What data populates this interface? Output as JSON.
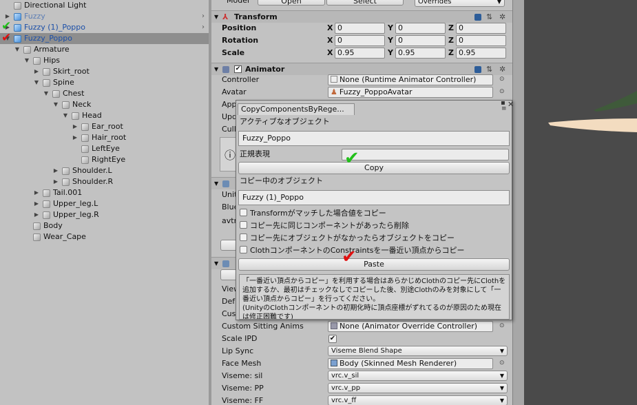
{
  "hierarchy": {
    "rows": [
      {
        "label": "Directional Light",
        "indent": 0,
        "arrow": "",
        "prefab": false,
        "faded": false
      },
      {
        "label": "Fuzzy",
        "indent": 0,
        "arrow": "▶",
        "prefab": true,
        "faded": true,
        "open": true
      },
      {
        "label": "Fuzzy (1)_Poppo",
        "indent": 0,
        "arrow": "▶",
        "prefab": true,
        "faded": false,
        "open": true
      },
      {
        "label": "Fuzzy_Poppo",
        "indent": 0,
        "arrow": "▼",
        "prefab": true,
        "faded": false,
        "selected": true
      },
      {
        "label": "Armature",
        "indent": 1,
        "arrow": "▼"
      },
      {
        "label": "Hips",
        "indent": 2,
        "arrow": "▼"
      },
      {
        "label": "Skirt_root",
        "indent": 3,
        "arrow": "▶"
      },
      {
        "label": "Spine",
        "indent": 3,
        "arrow": "▼"
      },
      {
        "label": "Chest",
        "indent": 4,
        "arrow": "▼"
      },
      {
        "label": "Neck",
        "indent": 5,
        "arrow": "▼"
      },
      {
        "label": "Head",
        "indent": 6,
        "arrow": "▼"
      },
      {
        "label": "Ear_root",
        "indent": 7,
        "arrow": "▶"
      },
      {
        "label": "Hair_root",
        "indent": 7,
        "arrow": "▶"
      },
      {
        "label": "LeftEye",
        "indent": 7,
        "arrow": ""
      },
      {
        "label": "RightEye",
        "indent": 7,
        "arrow": ""
      },
      {
        "label": "Shoulder.L",
        "indent": 5,
        "arrow": "▶"
      },
      {
        "label": "Shoulder.R",
        "indent": 5,
        "arrow": "▶"
      },
      {
        "label": "Tail.001",
        "indent": 3,
        "arrow": "▶"
      },
      {
        "label": "Upper_leg.L",
        "indent": 3,
        "arrow": "▶"
      },
      {
        "label": "Upper_leg.R",
        "indent": 3,
        "arrow": "▶"
      },
      {
        "label": "Body",
        "indent": 2,
        "arrow": ""
      },
      {
        "label": "Wear_Cape",
        "indent": 2,
        "arrow": ""
      }
    ]
  },
  "inspector": {
    "model_row": {
      "label": "Model",
      "open": "Open",
      "select": "Select",
      "overrides": "Overrides"
    },
    "transform": {
      "title": "Transform",
      "position_label": "Position",
      "rotation_label": "Rotation",
      "scale_label": "Scale",
      "axis_x": "X",
      "axis_y": "Y",
      "axis_z": "Z",
      "position": {
        "x": "0",
        "y": "0",
        "z": "0"
      },
      "rotation": {
        "x": "0",
        "y": "0",
        "z": "0"
      },
      "scale": {
        "x": "0.95",
        "y": "0.95",
        "z": "0.95"
      }
    },
    "animator": {
      "title": "Animator",
      "controller_label": "Controller",
      "controller_value": "None (Runtime Animator Controller)",
      "avatar_label": "Avatar",
      "avatar_value": "Fuzzy_PoppoAvatar",
      "apply_label": "App",
      "update_label": "Upd",
      "culling_label": "Cull"
    },
    "partial": {
      "unity_label": "Unit",
      "blue_label": "Blue",
      "avtr_label": "avtr",
      "view_label": "View",
      "def_label": "Def",
      "cus_label": "Cus"
    },
    "avatar_desc": {
      "sitting_label": "Custom Sitting Anims",
      "sitting_value": "None (Animator Override Controller)",
      "scale_ipd_label": "Scale IPD",
      "lip_sync_label": "Lip Sync",
      "lip_sync_value": "Viseme Blend Shape",
      "face_mesh_label": "Face Mesh",
      "face_mesh_value": "Body (Skinned Mesh Renderer)",
      "viseme_sil_label": "Viseme: sil",
      "viseme_sil_value": "vrc.v_sil",
      "viseme_pp_label": "Viseme: PP",
      "viseme_pp_value": "vrc.v_pp",
      "viseme_ff_label": "Viseme: FF",
      "viseme_ff_value": "vrc.v_ff"
    }
  },
  "window": {
    "tab_title": "CopyComponentsByRege...",
    "active_label": "アクティブなオブジェクト",
    "active_value": "Fuzzy_Poppo",
    "regex_label": "正規表現",
    "regex_value": "",
    "copy_button": "Copy",
    "copying_label": "コピー中のオブジェクト",
    "copying_value": "Fuzzy (1)_Poppo",
    "options": [
      "Transformがマッチした場合値をコピー",
      "コピー先に同じコンポーネントがあったら削除",
      "コピー先にオブジェクトがなかったらオブジェクトをコピー",
      "ClothコンポーネントのConstraintsを一番近い頂点からコピー"
    ],
    "paste_button": "Paste",
    "help_text": "「一番近い頂点からコピー」を利用する場合はあらかじめClothのコピー先にClothを追加するか、最初はチェックなしでコピーした後、別途Clothのみを対象にして「一番近い頂点からコピー」を行ってください。\n(UnityのClothコンポーネントの初期化時に頂点座標がずれてるのが原因のため現在は修正困難です)"
  },
  "annotation_colors": {
    "green": "#22c01a",
    "red": "#e01010"
  }
}
